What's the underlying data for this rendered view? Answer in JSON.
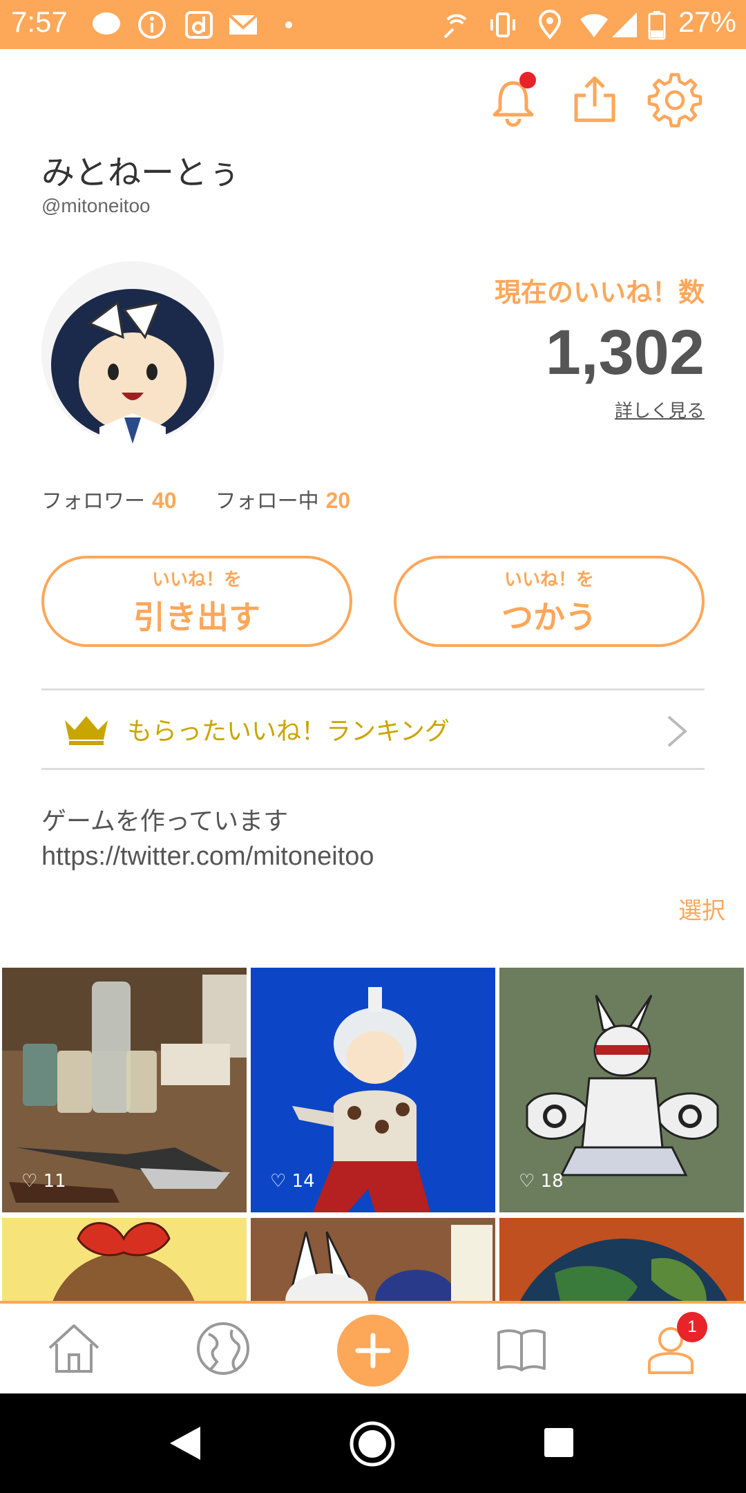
{
  "status_bar": {
    "time": "7:57",
    "battery": "27%"
  },
  "profile": {
    "display_name": "みとねーとぅ",
    "user_id": "@mitoneitoo",
    "likes_label": "現在のいいね！数",
    "likes_count": "1,302",
    "likes_detail": "詳しく見る",
    "followers_label": "フォロワー",
    "followers_count": "40",
    "following_label": "フォロー中",
    "following_count": "20"
  },
  "actions": {
    "withdraw_small": "いいね！を",
    "withdraw_big": "引き出す",
    "use_small": "いいね！を",
    "use_big": "つかう"
  },
  "ranking": {
    "label": "もらったいいね！ランキング"
  },
  "bio": {
    "text": "ゲームを作っています",
    "url": "https://twitter.com/mitoneitoo"
  },
  "select_label": "選択",
  "posts": [
    {
      "likes": "11"
    },
    {
      "likes": "14"
    },
    {
      "likes": "18"
    }
  ],
  "tabbar": {
    "profile_badge": "1"
  },
  "icons": {
    "notification": "bell-icon",
    "share": "share-icon",
    "settings": "gear-icon",
    "ranking": "crown-icon",
    "home": "home-icon",
    "explore": "globe-icon",
    "post": "plus-icon",
    "book": "book-icon",
    "profile": "user-icon"
  },
  "colors": {
    "accent": "#fda759",
    "crown": "#c9a500",
    "badge": "#e8232a"
  }
}
